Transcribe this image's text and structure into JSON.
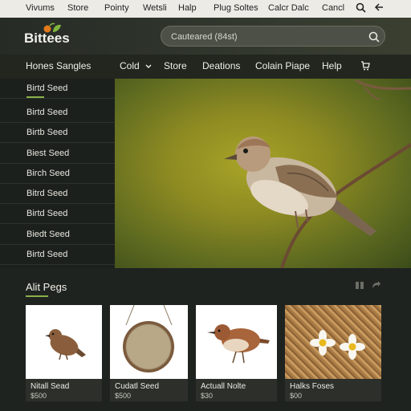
{
  "topbar": {
    "links": [
      "Vivums",
      "Store",
      "Pointy",
      "Wetsli",
      "Halp",
      "Plug Soltes",
      "Calcr Dalc",
      "Cancl"
    ],
    "icons": [
      "search-icon",
      "back-arrow-icon"
    ]
  },
  "header": {
    "logo": "Bittees",
    "search_placeholder": "Cauteared (84st)"
  },
  "nav": {
    "left": "Hones Sangles",
    "items": [
      "Cold",
      "Store",
      "Deations",
      "Colain Piape",
      "Help"
    ],
    "icons": [
      "chevron-down-icon",
      "cart-icon"
    ]
  },
  "sidebar": {
    "items": [
      "Birtd Seed",
      "Birtd Seed",
      "Birtb Seed",
      "Biest Seed",
      "Birch Seed",
      "Bitrd Seed",
      "Birtd Seed",
      "Biedt Seed",
      "Birtd Seed"
    ]
  },
  "section": {
    "title": "Alit Pegs",
    "icons": [
      "grid-icon",
      "share-icon"
    ]
  },
  "cards": [
    {
      "caption": "Nitall Sead",
      "price": "$500"
    },
    {
      "caption": "Cudatl Seed",
      "price": "$500"
    },
    {
      "caption": "Actuall Nolte",
      "price": "$30"
    },
    {
      "caption": "Halks Foses",
      "price": "$00"
    }
  ],
  "colors": {
    "accent": "#8ab04a",
    "header_dark": "#262b26",
    "topbar": "#ecebe6"
  }
}
